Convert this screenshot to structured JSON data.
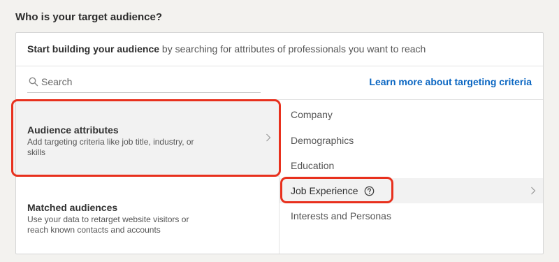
{
  "section_title": "Who is your target audience?",
  "card_header": {
    "bold": "Start building your audience",
    "rest": " by searching for attributes of professionals you want to reach"
  },
  "search": {
    "placeholder": "Search"
  },
  "learn_link": "Learn more about targeting criteria",
  "left_items": [
    {
      "title": "Audience attributes",
      "description": "Add targeting criteria like job title, industry, or skills",
      "selected": true
    },
    {
      "title": "Matched audiences",
      "description": "Use your data to retarget website visitors or reach known contacts and accounts",
      "selected": false
    }
  ],
  "right_items": [
    {
      "label": "Company"
    },
    {
      "label": "Demographics"
    },
    {
      "label": "Education"
    },
    {
      "label": "Job Experience",
      "selected": true,
      "help_icon": "help-circle-icon"
    },
    {
      "label": "Interests and Personas"
    }
  ],
  "colors": {
    "accent_link": "#0a66c2",
    "highlight_outline": "#e8301d",
    "selected_row_bg": "#f2f2f2"
  }
}
